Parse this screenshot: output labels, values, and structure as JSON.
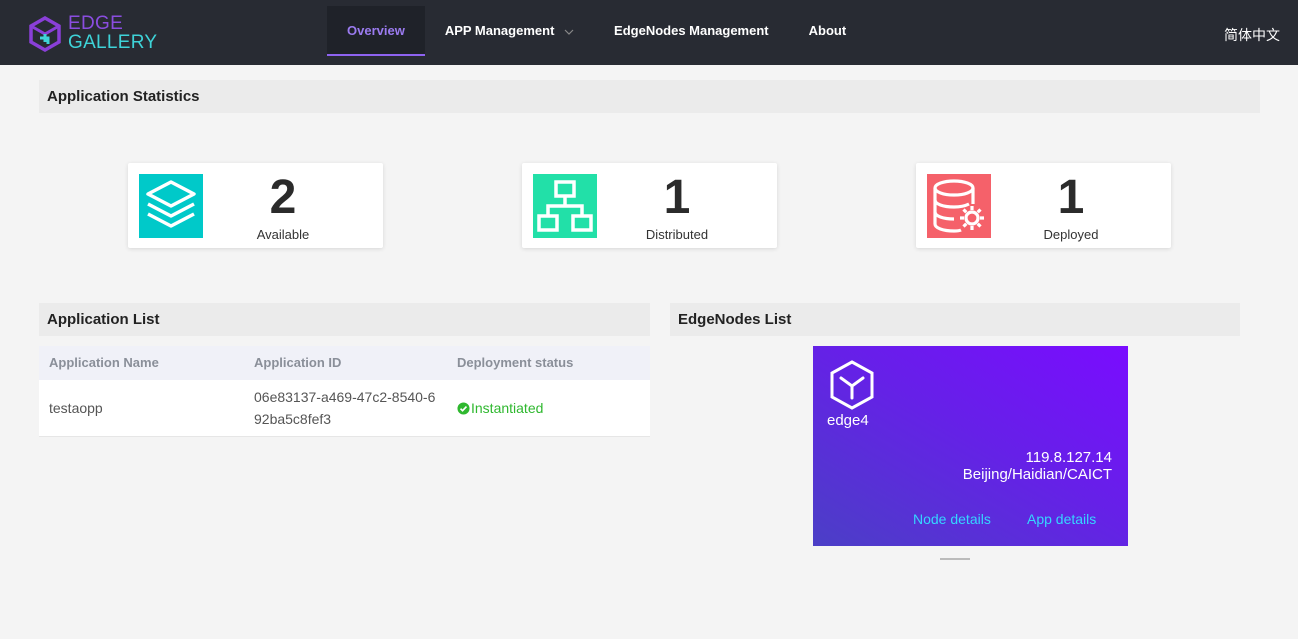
{
  "brand": {
    "line1": "EDGE",
    "line2": "GALLERY"
  },
  "nav": {
    "items": [
      {
        "label": "Overview",
        "active": true
      },
      {
        "label": "APP Management",
        "dropdown": true
      },
      {
        "label": "EdgeNodes Management"
      },
      {
        "label": "About"
      }
    ],
    "language": "简体中文"
  },
  "statistics": {
    "title": "Application Statistics",
    "cards": [
      {
        "value": "2",
        "label": "Available",
        "icon": "layers-icon",
        "color": "#00c9c9"
      },
      {
        "value": "1",
        "label": "Distributed",
        "icon": "hierarchy-icon",
        "color": "#22e0a8"
      },
      {
        "value": "1",
        "label": "Deployed",
        "icon": "database-gear-icon",
        "color": "#f5616a"
      }
    ]
  },
  "app_list": {
    "title": "Application List",
    "columns": [
      "Application Name",
      "Application ID",
      "Deployment status"
    ],
    "rows": [
      {
        "name": "testaopp",
        "id_line1": "06e83137-a469-47c2-8540-6",
        "id_line2": "92ba5c8fef3",
        "status": "Instantiated"
      }
    ]
  },
  "edge_nodes": {
    "title": "EdgeNodes List",
    "nodes": [
      {
        "name": "edge4",
        "ip": "119.8.127.14",
        "location": "Beijing/Haidian/CAICT",
        "node_details": "Node details",
        "app_details": "App details"
      }
    ]
  }
}
